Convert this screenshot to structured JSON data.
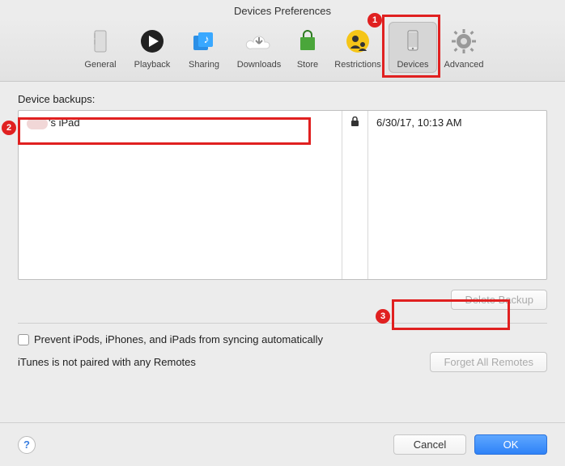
{
  "window": {
    "title": "Devices Preferences"
  },
  "toolbar": {
    "items": [
      {
        "label": "General"
      },
      {
        "label": "Playback"
      },
      {
        "label": "Sharing"
      },
      {
        "label": "Downloads"
      },
      {
        "label": "Store"
      },
      {
        "label": "Restrictions"
      },
      {
        "label": "Devices",
        "selected": true
      },
      {
        "label": "Advanced"
      }
    ]
  },
  "backups": {
    "heading": "Device backups:",
    "rows": [
      {
        "name_suffix": "'s iPad",
        "locked": true,
        "date": "6/30/17, 10:13 AM"
      }
    ],
    "delete_label": "Delete Backup"
  },
  "options": {
    "prevent_sync_label": "Prevent iPods, iPhones, and iPads from syncing automatically",
    "prevent_sync_checked": false,
    "remotes_status": "iTunes is not paired with any Remotes",
    "forget_remotes_label": "Forget All Remotes"
  },
  "footer": {
    "cancel": "Cancel",
    "ok": "OK",
    "help": "?"
  },
  "annotations": {
    "1": "1",
    "2": "2",
    "3": "3"
  }
}
